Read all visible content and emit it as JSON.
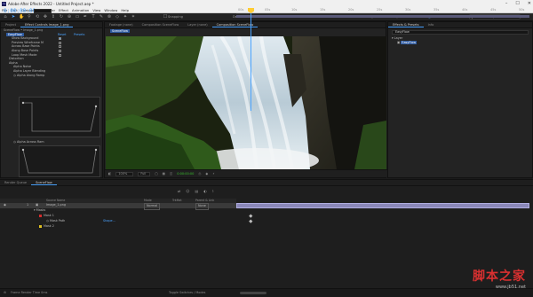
{
  "window": {
    "title": "Adobe After Effects 2022 - Untitled Project.aep *",
    "app_icon": "Ae"
  },
  "menu": [
    "File",
    "Edit",
    "Composition",
    "Layer",
    "Effect",
    "Animation",
    "View",
    "Window",
    "Help"
  ],
  "workspaces": [
    {
      "label": "Default",
      "active": false
    },
    {
      "label": "Review",
      "active": false
    },
    {
      "label": "Learn",
      "active": false
    },
    {
      "label": "Small Screen",
      "active": false
    },
    {
      "label": "Libraries",
      "active": false
    },
    {
      "label": "Layer",
      "active": false
    },
    {
      "label": "Graph",
      "active": false
    },
    {
      "label": "NEW_01",
      "active": true
    }
  ],
  "search_help": {
    "placeholder": "Search Help"
  },
  "snapping_label": "Snapping",
  "left_panel": {
    "tabs": [
      "Project",
      "Effect Controls Image_1.png"
    ],
    "layer_path": "SceneFlow • Image_1.png",
    "effect_name": "EasyFlow",
    "reset_label": "Reset",
    "presets_label": "Presets",
    "rows": [
      {
        "label": "Show Background",
        "checked": true
      },
      {
        "label": "Preview Wireframe M",
        "checked": false
      },
      {
        "label": "Across Base Points",
        "checked": false
      },
      {
        "label": "Along Base Points",
        "checked": false
      },
      {
        "label": "Loop Mesh Mode",
        "checked": false
      },
      {
        "label": "Distortion",
        "checked": null
      },
      {
        "label": "Alpha",
        "checked": null
      },
      {
        "label": "Alpha Noise",
        "checked": null
      },
      {
        "label": "Alpha Layer Blending",
        "checked": null
      },
      {
        "label": "Alpha Along Ramp",
        "checked": null
      }
    ],
    "alpha_across_label": "Alpha Across Ram"
  },
  "viewer": {
    "tabs": [
      "Footage (none)",
      "Composition SceneFlow",
      "Layer (none)",
      "Composition SceneFlow"
    ],
    "active_comp_label": "SceneFlow",
    "zoom": "100%",
    "resolution": "Full",
    "timecode": "0:00:00:00"
  },
  "effects_presets": {
    "tabs": [
      "Effects & Presets",
      "Info"
    ],
    "search_value": "EasyFlow",
    "group_label": "Layer",
    "result_label": "EasyFlow"
  },
  "timeline": {
    "tabs": [
      "Render Queue",
      "SceneFlow"
    ],
    "current_time": "0:00:00:00",
    "columns": [
      "Source Name",
      "Mode",
      "TrkMat",
      "Parent & Link"
    ],
    "layers": [
      {
        "num": "1",
        "name": "Image_1.png",
        "mode": "Normal",
        "parent": "None",
        "selected": true
      },
      {
        "num": "",
        "name": "Masks",
        "mode": "",
        "parent": "",
        "selected": false
      },
      {
        "num": "",
        "name": "Mask 1",
        "mode": "",
        "parent": "",
        "selected": false
      },
      {
        "num": "",
        "name": "Mask Path",
        "mode": "Shape...",
        "parent": "",
        "selected": false
      },
      {
        "num": "",
        "name": "Mask 2",
        "mode": "",
        "parent": "",
        "selected": false
      }
    ],
    "ruler_ticks": [
      "00s",
      "05s",
      "10s",
      "15s",
      "20s",
      "25s",
      "30s",
      "35s",
      "40s",
      "45s",
      "50s"
    ],
    "bottom_label": "Frame Render Time  0ms",
    "bottom_toggle": "Toggle Switches / Modes"
  },
  "watermark": {
    "text": "脚本之家",
    "url": "www.jb51.net"
  },
  "colors": {
    "accent": "#4aa3ff",
    "clip": "#8a87b8",
    "time_green": "#39c22d",
    "watermark_red": "#d93030"
  }
}
